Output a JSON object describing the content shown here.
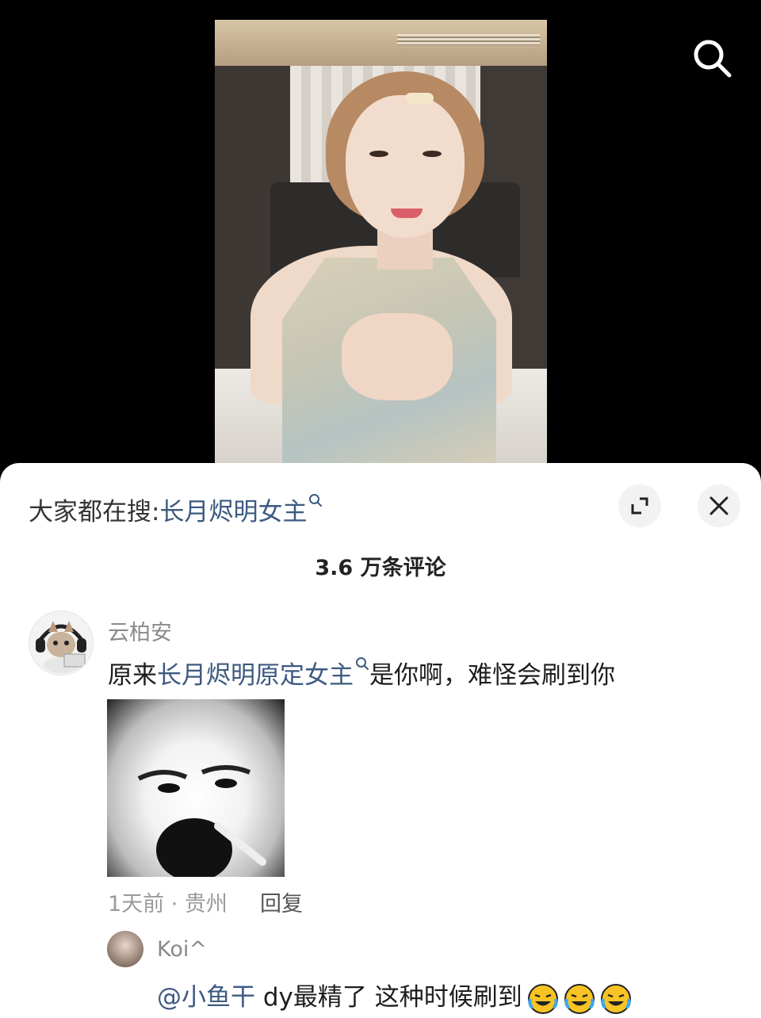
{
  "trending": {
    "prefix": "大家都在搜:",
    "term": "长月烬明女主"
  },
  "comments_header": {
    "count_label": "3.6 万条评论"
  },
  "comments": [
    {
      "username": "云柏安",
      "text_prefix": "原来",
      "text_link": "长月烬明原定女主",
      "text_suffix": "是你啊，难怪会刷到你",
      "meta": "1天前 · 贵州",
      "reply_label": "回复"
    },
    {
      "username": "Koi^",
      "mention": "@小鱼干",
      "text": " dy最精了 这种时候刷到"
    }
  ],
  "icons": {
    "search": "search-icon",
    "expand": "expand-icon",
    "close": "close-icon",
    "emoji": "laughing-crying-emoji"
  },
  "colors": {
    "link": "#3d5a80",
    "muted": "#8a8a8a",
    "text": "#1e1e1e"
  }
}
